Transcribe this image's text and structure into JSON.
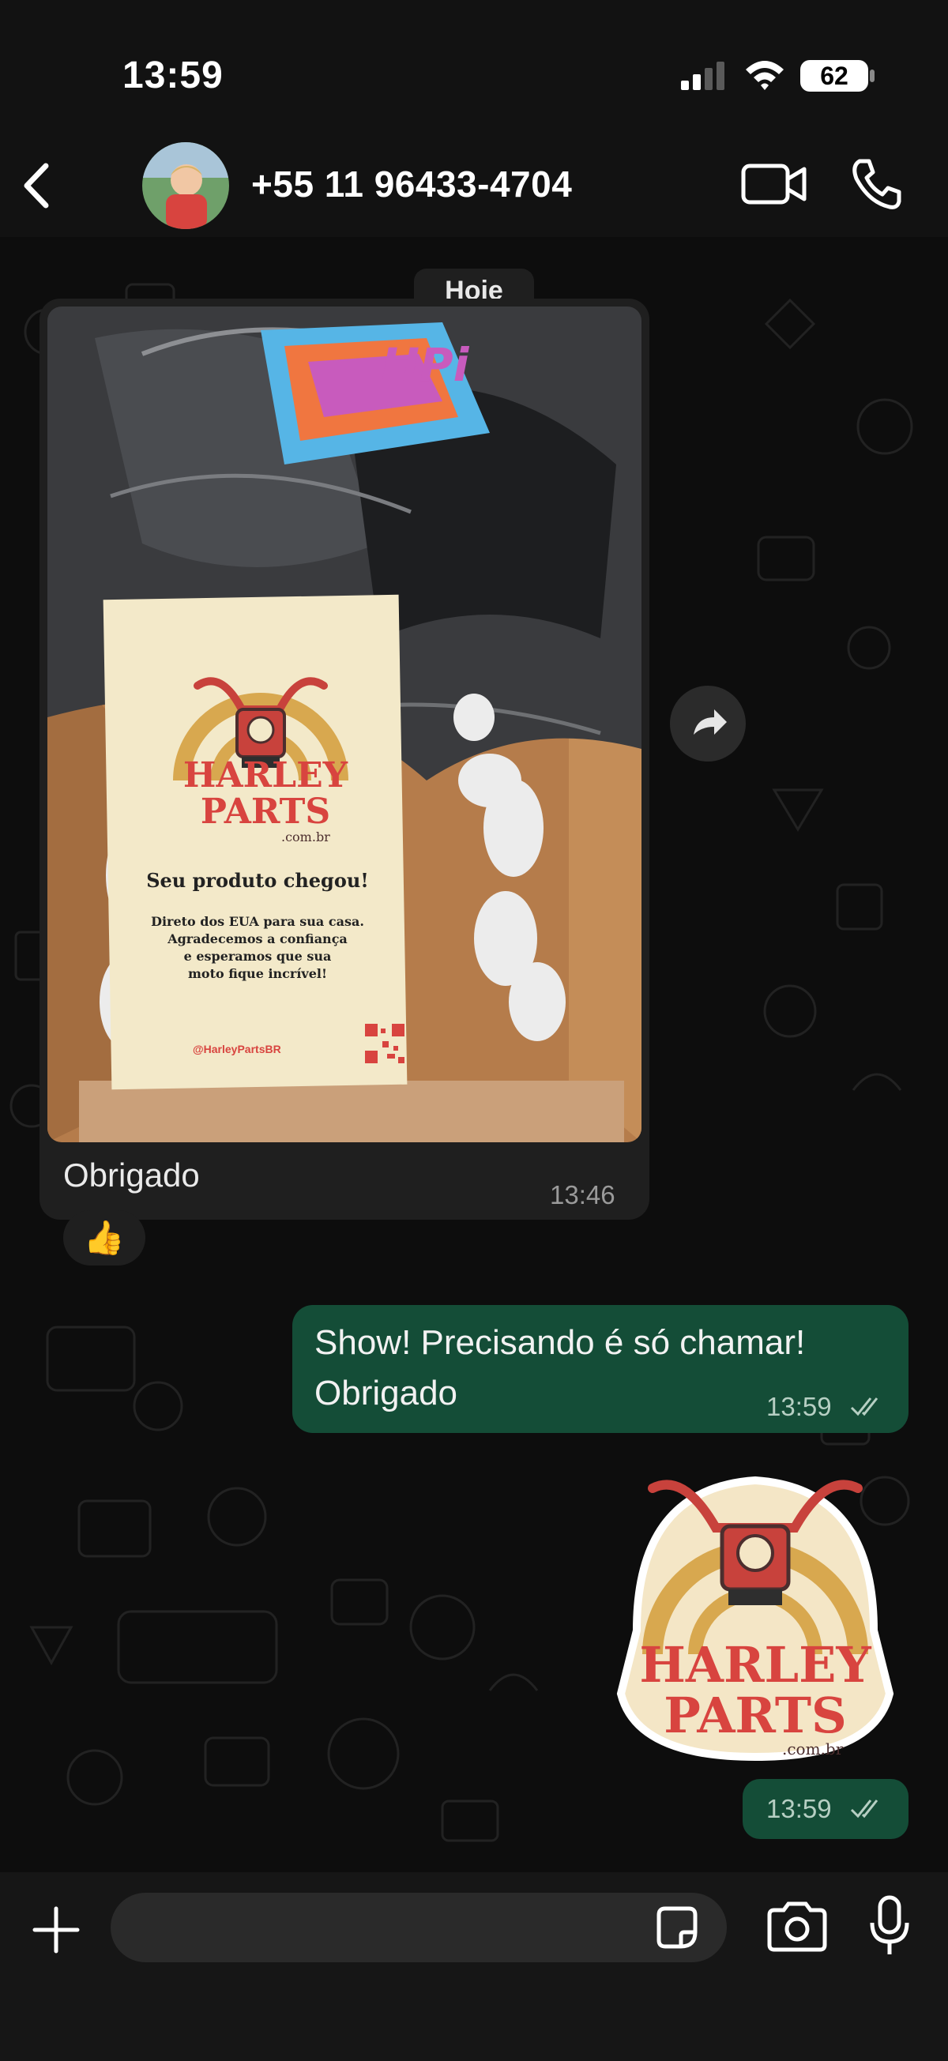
{
  "status_bar": {
    "time": "13:59",
    "battery": "62",
    "signal": "signal-icon",
    "wifi": "wifi-icon"
  },
  "header": {
    "back": "chevron-left-icon",
    "contact_name": "+55 11 96433-4704",
    "avatar": "avatar",
    "video_call": "video-camera-icon",
    "voice_call": "phone-icon"
  },
  "chat": {
    "date_divider": "Hoje",
    "messages": [
      {
        "direction": "in",
        "type": "image",
        "image_text": {
          "brand_line1": "HARLEY",
          "brand_line2": "PARTS",
          "brand_domain": ".com.br",
          "headline": "Seu produto chegou!",
          "body_line1": "Direto dos EUA para sua casa.",
          "body_line2": "Agradecemos a confiança",
          "body_line3": "e esperamos que sua",
          "body_line4": "moto fique incrível!",
          "handle": "@HarleyPartsBR",
          "sticker_text": "HPi"
        },
        "caption": "Obrigado",
        "time": "13:46",
        "reaction": "👍"
      },
      {
        "direction": "out",
        "type": "text",
        "line1": "Show! Precisando é só chamar!",
        "line2": "Obrigado",
        "time": "13:59",
        "status": "read"
      },
      {
        "direction": "out",
        "type": "sticker",
        "sticker_line1": "HARLEY",
        "sticker_line2": "PARTS",
        "sticker_domain": ".com.br",
        "time": "13:59",
        "status": "read"
      }
    ]
  },
  "composer": {
    "placeholder": "",
    "attach_icon": "plus-icon",
    "sticker_icon": "sticker-icon",
    "camera_icon": "camera-icon",
    "mic_icon": "microphone-icon"
  },
  "colors": {
    "outgoing_bubble": "#144d37",
    "incoming_bubble": "#1f1f1f",
    "background": "#0b0b0b",
    "brand_red": "#d8443f"
  }
}
